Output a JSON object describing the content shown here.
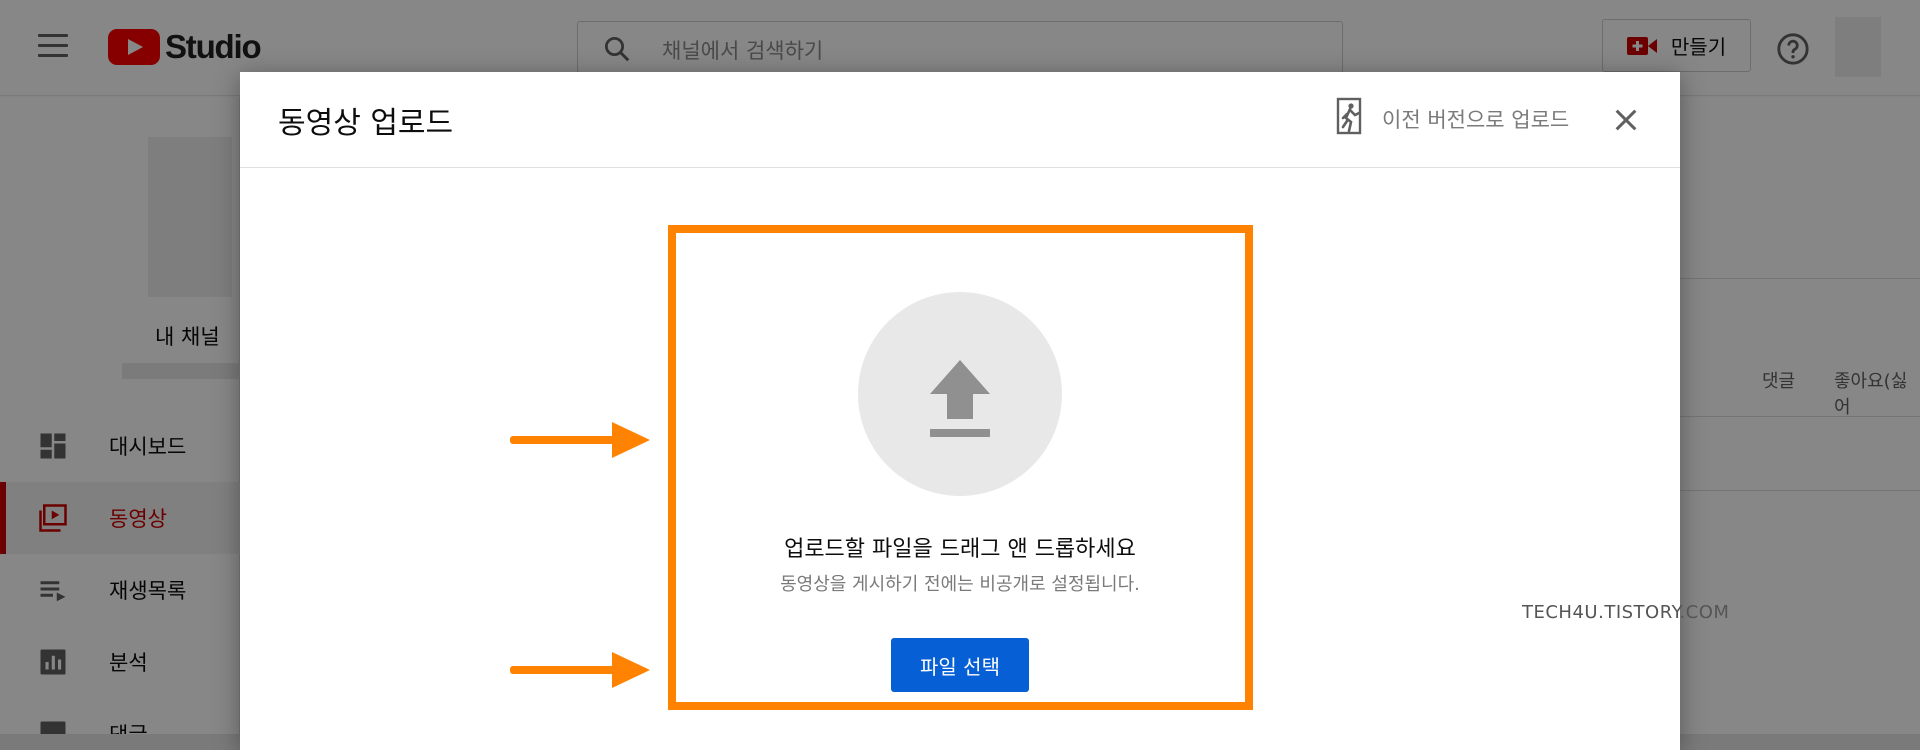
{
  "app": {
    "logo_text": "Studio",
    "search_placeholder": "채널에서 검색하기",
    "create_label": "만들기",
    "accent_color": "#065fd4",
    "brand_color": "#ff0000"
  },
  "sidebar": {
    "channel_label": "내 채널",
    "items": [
      {
        "label": "대시보드",
        "icon": "dashboard-icon",
        "active": false
      },
      {
        "label": "동영상",
        "icon": "videos-icon",
        "active": true
      },
      {
        "label": "재생목록",
        "icon": "playlist-icon",
        "active": false
      },
      {
        "label": "분석",
        "icon": "analytics-icon",
        "active": false
      },
      {
        "label": "댓글",
        "icon": "comments-icon",
        "active": false
      }
    ]
  },
  "background": {
    "columns": [
      "댓글",
      "좋아요(싫어"
    ]
  },
  "dialog": {
    "title": "동영상 업로드",
    "legacy_link": "이전 버전으로 업로드",
    "drop_title": "업로드할 파일을 드래그 앤 드롭하세요",
    "drop_subtitle": "동영상을 게시하기 전에는 비공개로 설정됩니다.",
    "select_button": "파일 선택",
    "highlight_color": "#ff8300"
  },
  "watermark": "TECH4U.TISTORY.COM"
}
